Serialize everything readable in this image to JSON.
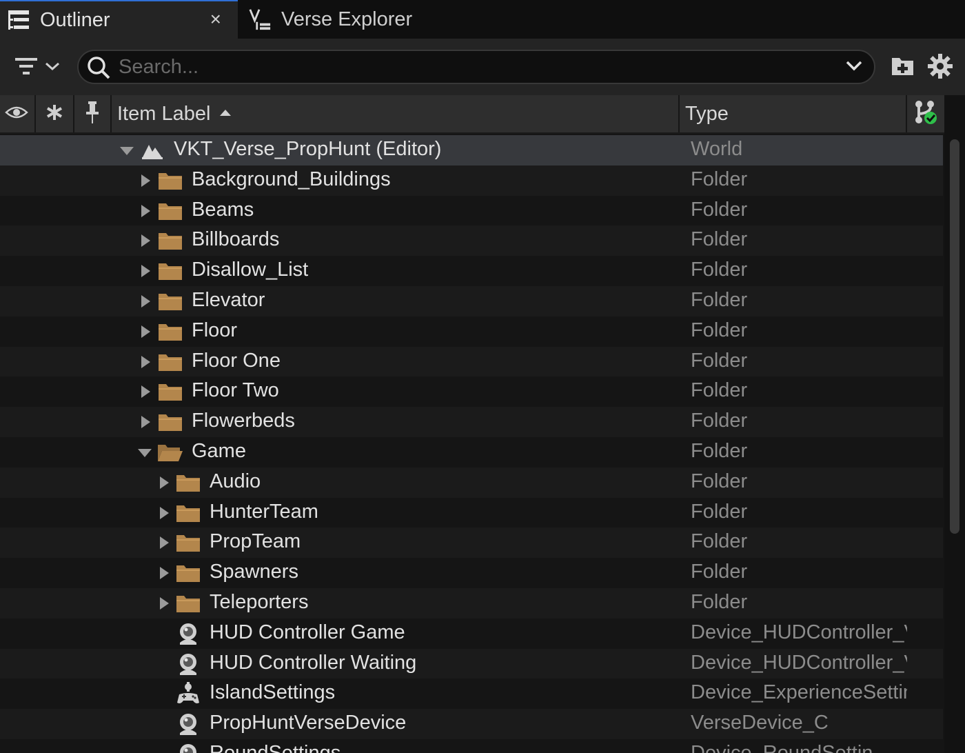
{
  "tabs": [
    {
      "label": "Outliner",
      "icon": "outliner-icon",
      "active": true,
      "close": "×"
    },
    {
      "label": "Verse Explorer",
      "icon": "verse-explorer-icon",
      "active": false
    }
  ],
  "search": {
    "placeholder": "Search..."
  },
  "columns": {
    "label": "Item Label",
    "type": "Type"
  },
  "colors": {
    "accent": "#2f6fd6",
    "folder": "#b3864c",
    "selected_row": "#37393d",
    "check_green": "#2fbf4a"
  },
  "rows": [
    {
      "label": "VKT_Verse_PropHunt (Editor)",
      "type": "World",
      "depth": 0,
      "icon": "world-icon",
      "expander": "expanded",
      "selected": true
    },
    {
      "label": "Background_Buildings",
      "type": "Folder",
      "depth": 1,
      "icon": "folder-icon",
      "expander": "collapsed"
    },
    {
      "label": "Beams",
      "type": "Folder",
      "depth": 1,
      "icon": "folder-icon",
      "expander": "collapsed"
    },
    {
      "label": "Billboards",
      "type": "Folder",
      "depth": 1,
      "icon": "folder-icon",
      "expander": "collapsed"
    },
    {
      "label": "Disallow_List",
      "type": "Folder",
      "depth": 1,
      "icon": "folder-icon",
      "expander": "collapsed"
    },
    {
      "label": "Elevator",
      "type": "Folder",
      "depth": 1,
      "icon": "folder-icon",
      "expander": "collapsed"
    },
    {
      "label": "Floor",
      "type": "Folder",
      "depth": 1,
      "icon": "folder-icon",
      "expander": "collapsed"
    },
    {
      "label": "Floor One",
      "type": "Folder",
      "depth": 1,
      "icon": "folder-icon",
      "expander": "collapsed"
    },
    {
      "label": "Floor Two",
      "type": "Folder",
      "depth": 1,
      "icon": "folder-icon",
      "expander": "collapsed"
    },
    {
      "label": "Flowerbeds",
      "type": "Folder",
      "depth": 1,
      "icon": "folder-icon",
      "expander": "collapsed"
    },
    {
      "label": "Game",
      "type": "Folder",
      "depth": 1,
      "icon": "folder-open-icon",
      "expander": "expanded"
    },
    {
      "label": "Audio",
      "type": "Folder",
      "depth": 2,
      "icon": "folder-icon",
      "expander": "collapsed"
    },
    {
      "label": "HunterTeam",
      "type": "Folder",
      "depth": 2,
      "icon": "folder-icon",
      "expander": "collapsed"
    },
    {
      "label": "PropTeam",
      "type": "Folder",
      "depth": 2,
      "icon": "folder-icon",
      "expander": "collapsed"
    },
    {
      "label": "Spawners",
      "type": "Folder",
      "depth": 2,
      "icon": "folder-icon",
      "expander": "collapsed"
    },
    {
      "label": "Teleporters",
      "type": "Folder",
      "depth": 2,
      "icon": "folder-icon",
      "expander": "collapsed"
    },
    {
      "label": "HUD Controller Game",
      "type": "Device_HUDController_V",
      "depth": 2,
      "icon": "device-icon",
      "expander": "none"
    },
    {
      "label": "HUD Controller Waiting",
      "type": "Device_HUDController_V",
      "depth": 2,
      "icon": "device-icon",
      "expander": "none"
    },
    {
      "label": "IslandSettings",
      "type": "Device_ExperienceSettin",
      "depth": 2,
      "icon": "gamepad-icon",
      "expander": "none"
    },
    {
      "label": "PropHuntVerseDevice",
      "type": "VerseDevice_C",
      "depth": 2,
      "icon": "device-icon",
      "expander": "none"
    },
    {
      "label": "RoundSettings",
      "type": "Device_RoundSettin",
      "depth": 2,
      "icon": "device-icon",
      "expander": "none"
    }
  ]
}
